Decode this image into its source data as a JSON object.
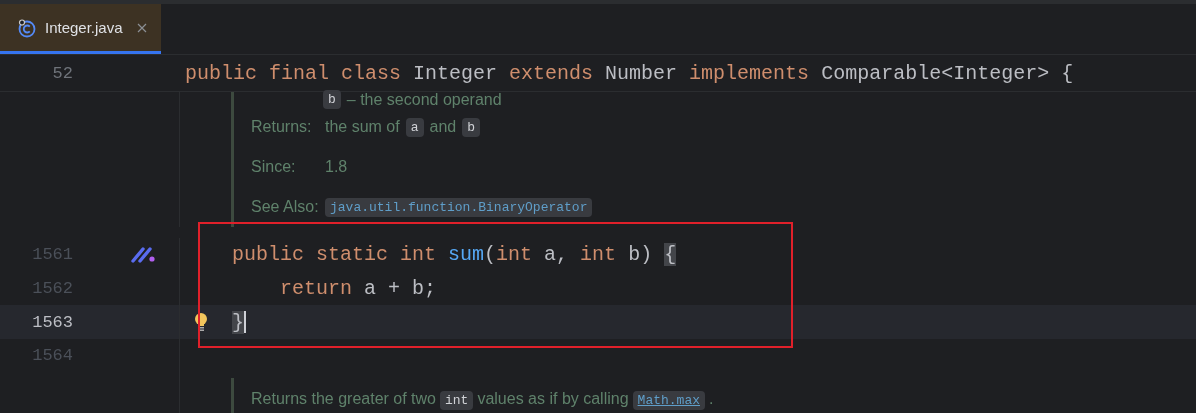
{
  "tabs": [
    {
      "label": "Integer.java",
      "selected": true,
      "closable": true
    }
  ],
  "sticky_line": {
    "number": "52",
    "tokens": [
      {
        "kind": "keyword",
        "text": "public final class "
      },
      {
        "kind": "plain",
        "text": "Integer "
      },
      {
        "kind": "keyword",
        "text": "extends "
      },
      {
        "kind": "plain",
        "text": "Number "
      },
      {
        "kind": "keyword",
        "text": "implements "
      },
      {
        "kind": "plain",
        "text": "Comparable<Integer> {"
      }
    ]
  },
  "doc_top": [
    {
      "kind": "param",
      "parts": [
        {
          "kind": "code",
          "text": "b"
        },
        {
          "kind": "text",
          "text": "– the second operand"
        }
      ]
    },
    {
      "kind": "tag",
      "label": "Returns:",
      "parts": [
        {
          "kind": "text",
          "text": "the sum of"
        },
        {
          "kind": "code",
          "text": "a"
        },
        {
          "kind": "text",
          "text": "and"
        },
        {
          "kind": "code",
          "text": "b"
        }
      ]
    },
    {
      "kind": "tag",
      "label": "Since:",
      "parts": [
        {
          "kind": "text",
          "text": "1.8"
        }
      ]
    },
    {
      "kind": "tag",
      "label": "See Also:",
      "parts": [
        {
          "kind": "link",
          "text": "java.util.function.BinaryOperator"
        }
      ]
    }
  ],
  "code_lines": [
    {
      "number": "1561",
      "current": false,
      "gutter_icon": true,
      "bulb": false,
      "tokens": [
        {
          "kind": "keyword",
          "text": "    public static int "
        },
        {
          "kind": "method",
          "text": "sum"
        },
        {
          "kind": "plain",
          "text": "("
        },
        {
          "kind": "keyword",
          "text": "int "
        },
        {
          "kind": "plain",
          "text": "a, "
        },
        {
          "kind": "keyword",
          "text": "int "
        },
        {
          "kind": "plain",
          "text": "b) "
        },
        {
          "kind": "brace",
          "text": "{"
        }
      ]
    },
    {
      "number": "1562",
      "current": false,
      "gutter_icon": false,
      "bulb": false,
      "tokens": [
        {
          "kind": "keyword",
          "text": "        return "
        },
        {
          "kind": "plain",
          "text": "a + b;"
        }
      ]
    },
    {
      "number": "1563",
      "current": true,
      "gutter_icon": false,
      "bulb": true,
      "tokens": [
        {
          "kind": "brace",
          "text": "    }"
        }
      ]
    },
    {
      "number": "1564",
      "current": false,
      "gutter_icon": false,
      "bulb": false
    }
  ],
  "doc_bottom": [
    {
      "parts": [
        {
          "kind": "text",
          "text": "Returns the greater of two"
        },
        {
          "kind": "code",
          "text": "int"
        },
        {
          "kind": "text",
          "text": "values as if by calling"
        },
        {
          "kind": "underlined_link",
          "text": "Math.max"
        },
        {
          "kind": "text",
          "text": "."
        }
      ]
    }
  ],
  "highlight_frame": true
}
